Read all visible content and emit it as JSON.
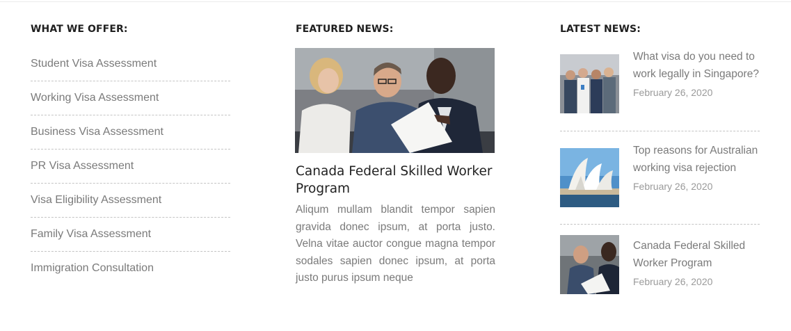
{
  "offer": {
    "heading": "WHAT WE OFFER:",
    "items": [
      {
        "label": "Student Visa Assessment"
      },
      {
        "label": "Working Visa Assessment"
      },
      {
        "label": "Business Visa Assessment"
      },
      {
        "label": "PR Visa Assessment"
      },
      {
        "label": "Visa Eligibility Assessment"
      },
      {
        "label": "Family Visa Assessment"
      },
      {
        "label": "Immigration Consultation"
      }
    ]
  },
  "featured": {
    "heading": "FEATURED NEWS:",
    "title": "Canada Federal Skilled Worker Program",
    "excerpt": "Aliqum mullam blandit tempor sapien gravida donec ipsum, at porta justo. Velna vitae auctor congue magna tempor sodales sapien donec ipsum, at porta justo purus ipsum neque"
  },
  "latest": {
    "heading": "LATEST NEWS:",
    "items": [
      {
        "title": "What visa do you need to work legally in Singapore?",
        "date": "February 26, 2020"
      },
      {
        "title": "Top reasons for Australian working visa rejection",
        "date": "February 26, 2020"
      },
      {
        "title": "Canada Federal Skilled Worker Program",
        "date": "February 26, 2020"
      }
    ]
  }
}
